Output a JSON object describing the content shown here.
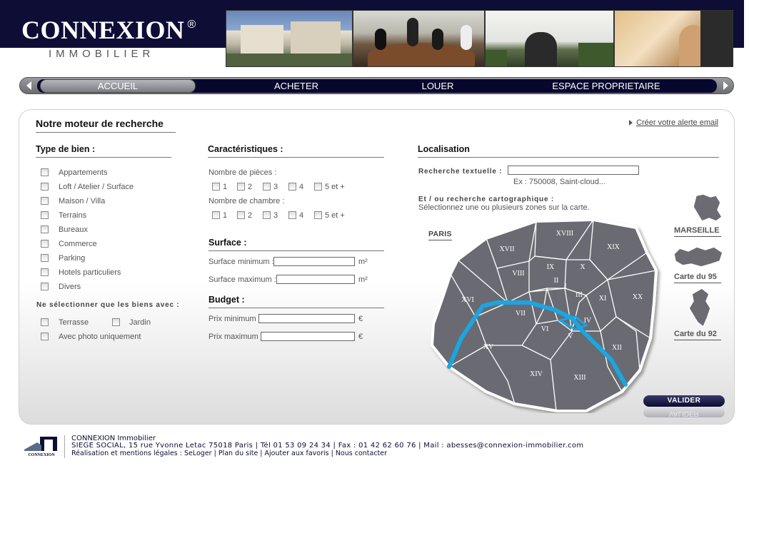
{
  "header": {
    "logo_main": "CONNEXION",
    "logo_reg": "®",
    "logo_sub": "IMMOBILIER"
  },
  "nav": {
    "items": [
      "ACCUEIL",
      "ACHETER",
      "LOUER",
      "ESPACE PROPRIETAIRE"
    ]
  },
  "search": {
    "title": "Notre moteur de recherche",
    "alert_link": "Créer votre alerte email",
    "type_bien": {
      "title": "Type de bien :",
      "options": [
        "Appartements",
        "Loft / Atelier / Surface",
        "Maison / Villa",
        "Terrains",
        "Bureaux",
        "Commerce",
        "Parking",
        "Hotels particuliers",
        "Divers"
      ],
      "filter_note": "Ne sélectionner que les biens avec :",
      "extras": [
        "Terrasse",
        "Jardin",
        "Avec photo uniquement"
      ]
    },
    "caracteristiques": {
      "title": "Caractéristiques :",
      "pieces_label": "Nombre de pièces :",
      "chambres_label": "Nombre de chambre :",
      "options": [
        "1",
        "2",
        "3",
        "4",
        "5 et +"
      ]
    },
    "surface": {
      "title": "Surface :",
      "min_label": "Surface minimum :",
      "max_label": "Surface maximum :",
      "unit": "m²"
    },
    "budget": {
      "title": "Budget :",
      "min_label": "Prix minimum :",
      "max_label": "Prix maximum :",
      "unit": "€"
    },
    "localisation": {
      "title": "Localisation",
      "text_search_label": "Recherche textuelle :",
      "text_search_example": "Ex : 750008, Saint-cloud...",
      "carto_title": "Et / ou recherche cartographique :",
      "carto_desc": "Sélectionnez une ou plusieurs zones sur la carte.",
      "paris_label": "PARIS",
      "side_maps": [
        "MARSEILLE",
        "Carte du 95",
        "Carte du 92"
      ],
      "arrondissements": [
        "I",
        "II",
        "III",
        "IV",
        "V",
        "VI",
        "VII",
        "VIII",
        "IX",
        "X",
        "XI",
        "XII",
        "XIII",
        "XIV",
        "XV",
        "XVI",
        "XVII",
        "XVIII",
        "XIX",
        "XX"
      ]
    },
    "submit_label": "VALIDER"
  },
  "footer": {
    "company": "CONNEXION Immobilier",
    "address": "SIEGE SOCIAL, 15 rue Yvonne Letac 75018 Paris | Tél 01 53 09 24 34 | Fax : 01 42 62 60 76 | Mail : abesses@connexion-immobilier.com",
    "links": "Réalisation et mentions légales : SeLoger | Plan du site | Ajouter aux favoris | Nous contacter",
    "logo_text": "CONNEXION"
  },
  "colors": {
    "brand_dark": "#0d0d35",
    "map_fill": "#6b6b72",
    "seine": "#1aa6e0"
  }
}
